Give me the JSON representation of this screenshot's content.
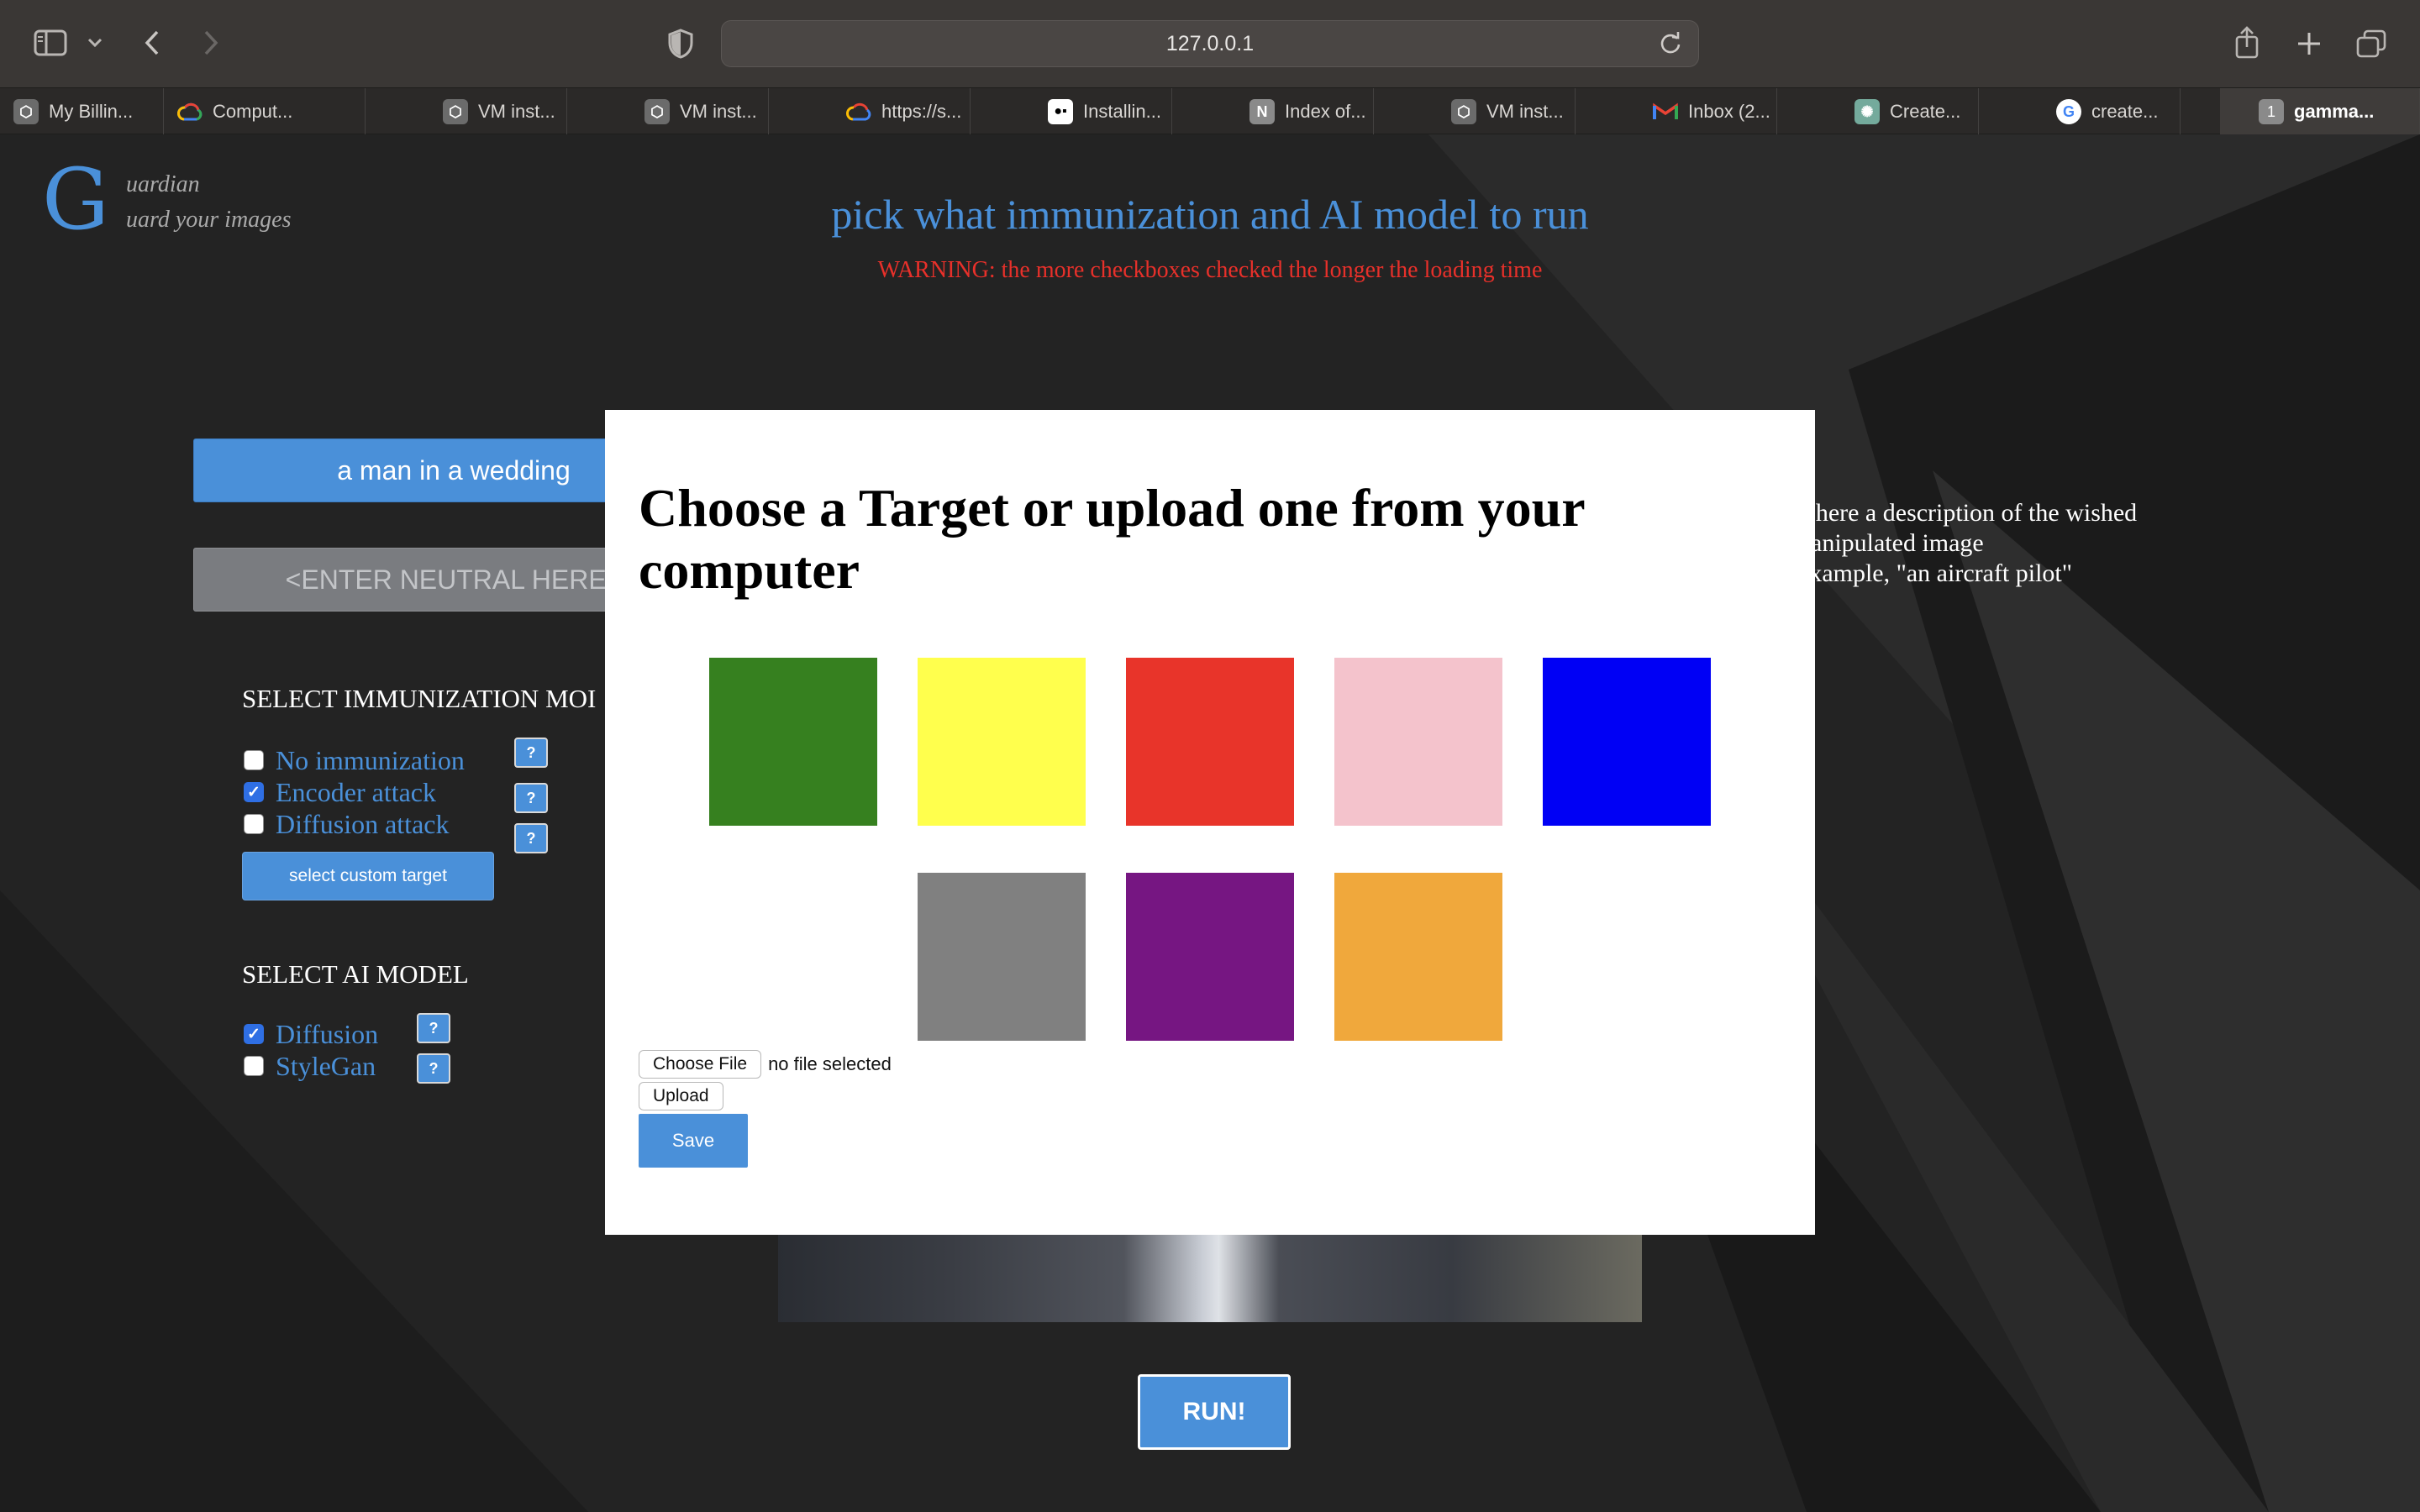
{
  "browser": {
    "url": "127.0.0.1",
    "tabs": [
      {
        "label": "My Billin...",
        "favicon": "gcp-icon"
      },
      {
        "label": "Comput...",
        "favicon": "google-cloud-icon"
      },
      {
        "label": "VM inst...",
        "favicon": "gcp-icon"
      },
      {
        "label": "VM inst...",
        "favicon": "gcp-icon"
      },
      {
        "label": "https://s...",
        "favicon": "google-cloud-icon"
      },
      {
        "label": "Installin...",
        "favicon": "medium-icon"
      },
      {
        "label": "Index of...",
        "favicon": "n-icon"
      },
      {
        "label": "VM inst...",
        "favicon": "gcp-icon"
      },
      {
        "label": "Inbox (2...",
        "favicon": "gmail-icon"
      },
      {
        "label": "Create...",
        "favicon": "openai-icon"
      },
      {
        "label": "create...",
        "favicon": "google-icon"
      },
      {
        "label": "gamma...",
        "favicon": "numbered-icon",
        "badge": "1",
        "active": true
      }
    ]
  },
  "app": {
    "logo_letter": "G",
    "logo_line1": "uardian",
    "logo_line2": "uard your images",
    "heading": "pick what immunization and AI model to run",
    "warning": "WARNING: the more checkboxes checked the longer the loading time",
    "target_prompt": "a man in a wedding",
    "neutral_placeholder": "<ENTER NEUTRAL HERE>",
    "immunization_title": "SELECT IMMUNIZATION MOI",
    "immunization_options": [
      {
        "label": "No immunization",
        "checked": false
      },
      {
        "label": "Encoder attack",
        "checked": true
      },
      {
        "label": "Diffusion attack",
        "checked": false
      }
    ],
    "help_label": "?",
    "custom_target_label": "select custom target",
    "model_title": "SELECT AI MODEL",
    "model_options": [
      {
        "label": "Diffusion",
        "checked": true
      },
      {
        "label": "StyleGan",
        "checked": false
      }
    ],
    "description_lines": [
      "e here a description of the wished",
      "nanipulated image",
      " example, \"an aircraft pilot\""
    ],
    "run_label": "RUN!"
  },
  "modal": {
    "title": "Choose a Target or upload one from your computer",
    "swatches": [
      "#36801f",
      "#ffff4d",
      "#e8342a",
      "#f4c3cc",
      "#0000f5",
      "#808080",
      "#761682",
      "#f0a83c"
    ],
    "choose_file_label": "Choose File",
    "file_status": "no file selected",
    "upload_label": "Upload",
    "save_label": "Save"
  },
  "colors": {
    "accent": "#4a90d9",
    "warning": "#e8302a"
  }
}
